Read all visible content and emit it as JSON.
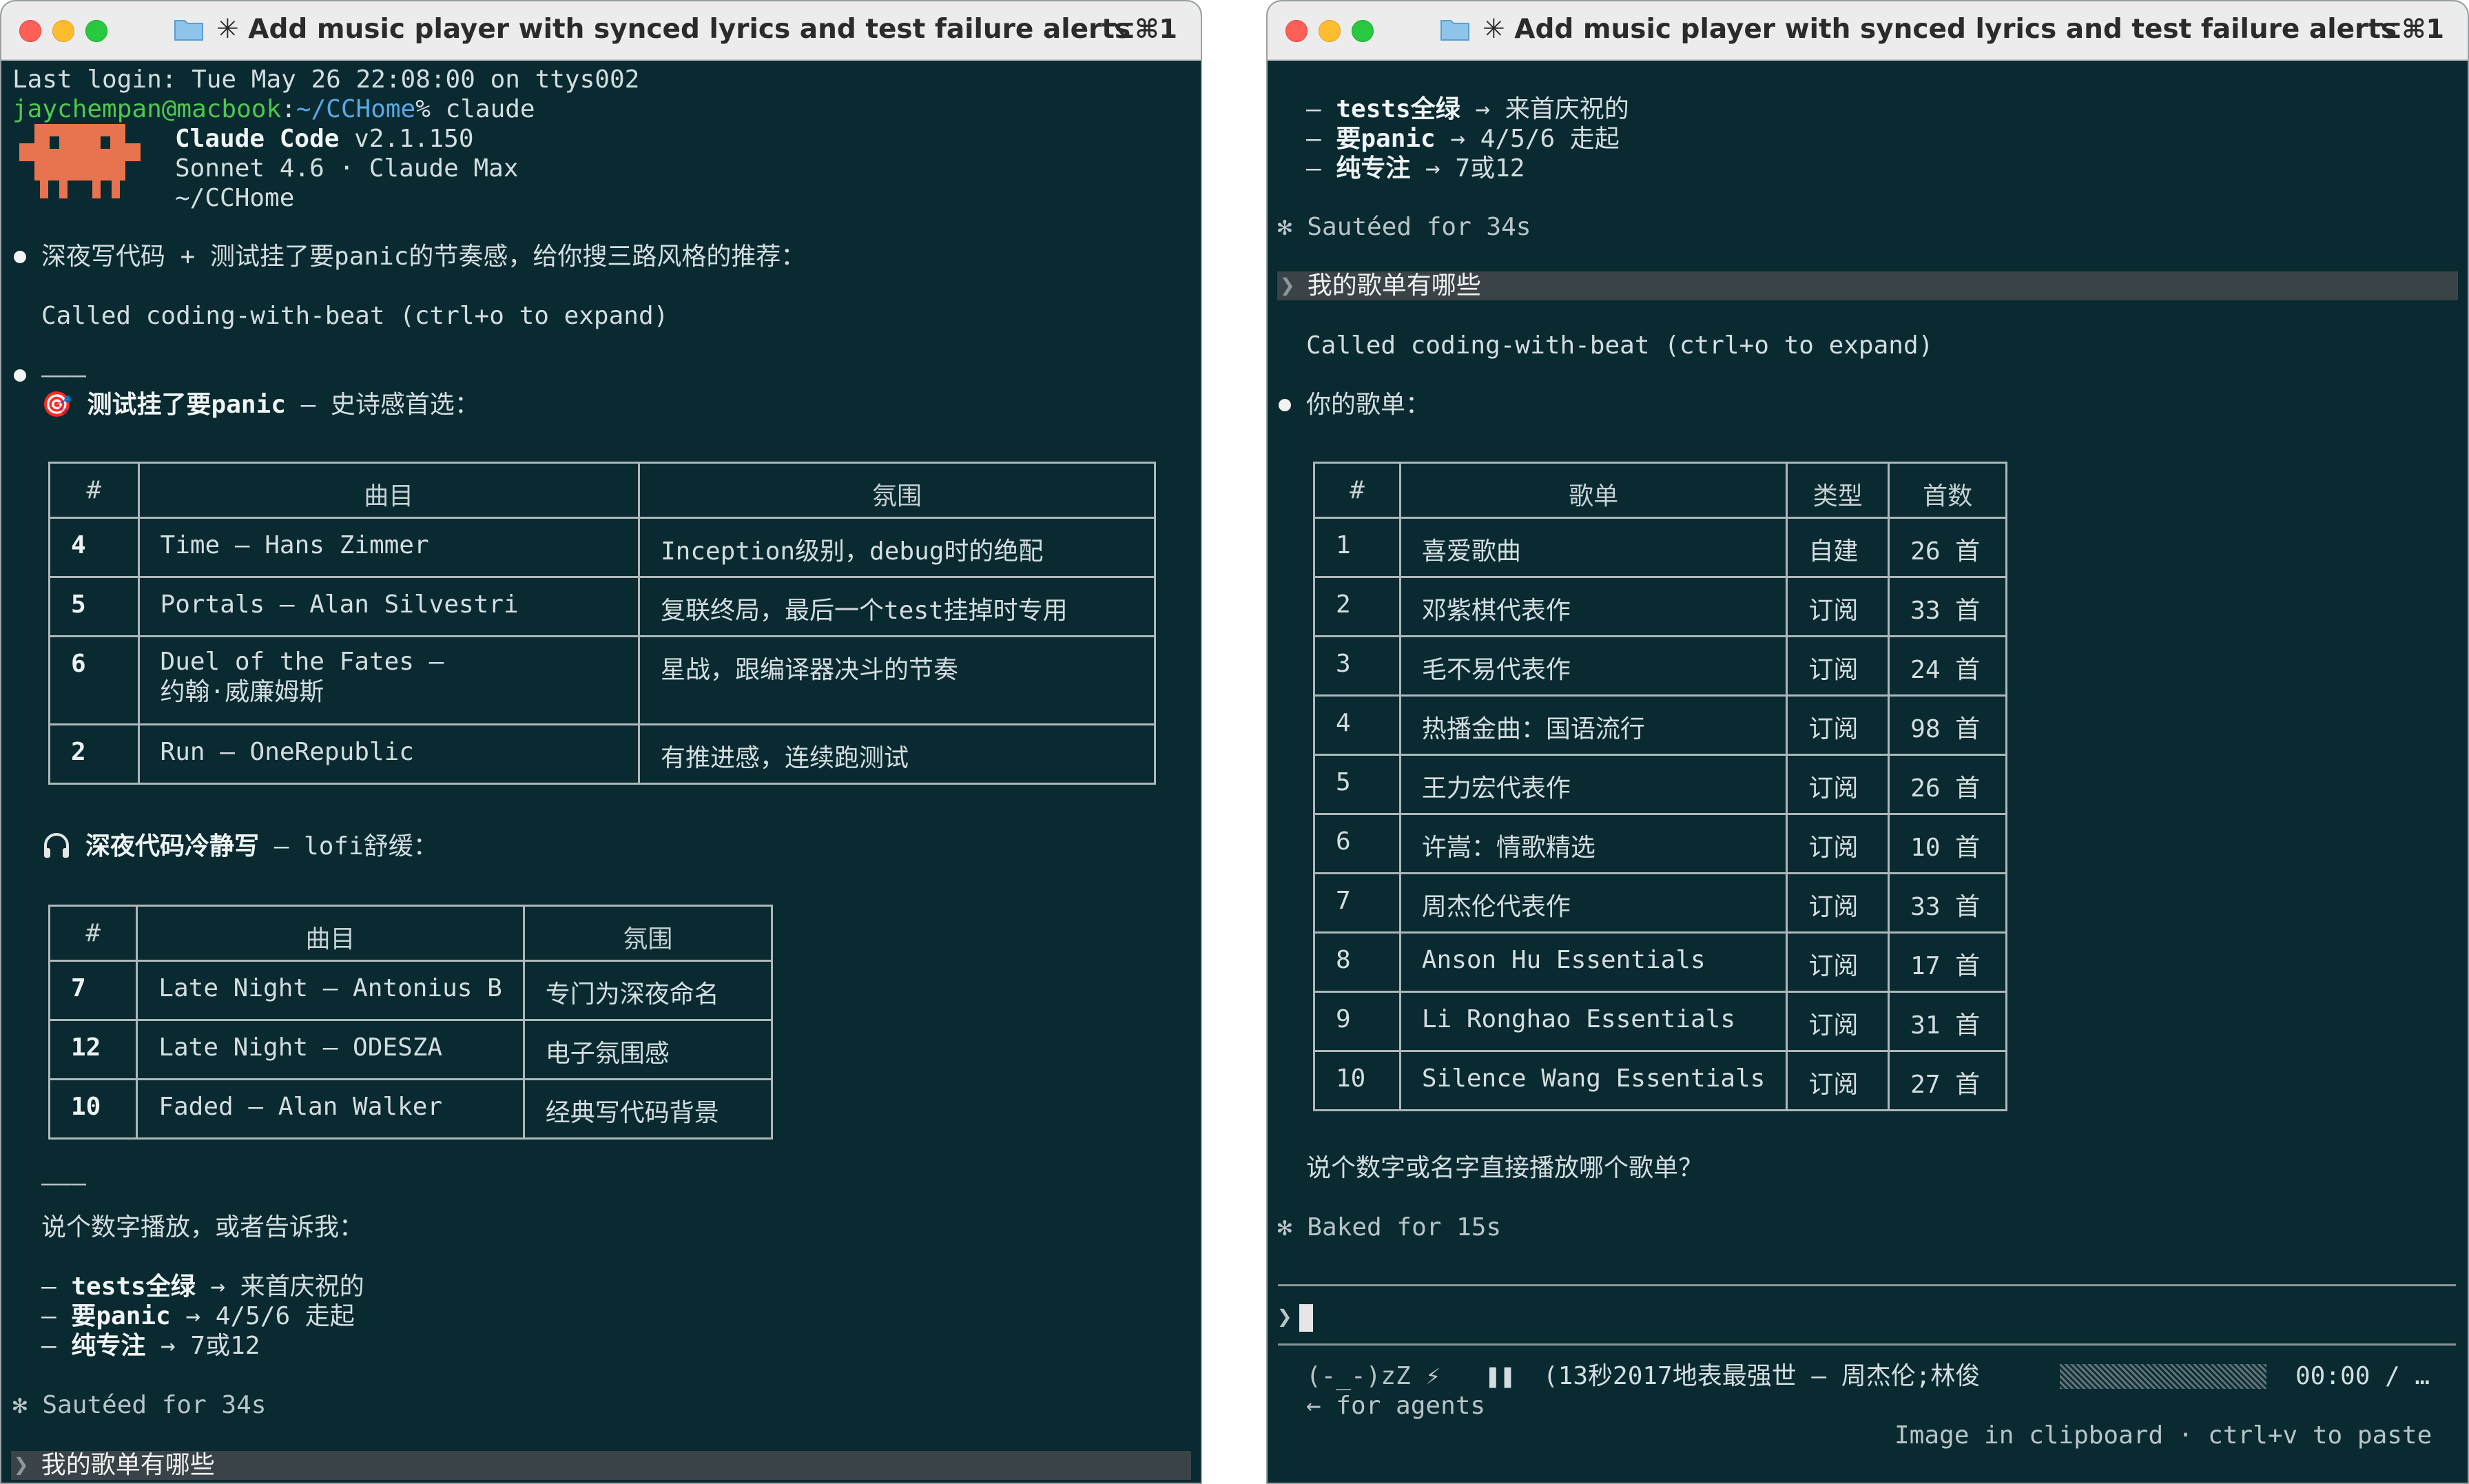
{
  "window": {
    "title": "✳ Add music player with synced lyrics and test failure alerts",
    "shortcut": "⌥⌘1"
  },
  "colors": {
    "terminal_bg": "#082a30",
    "user_bar_bg": "#3a4347",
    "prompt_user": "#4ec94e",
    "prompt_path": "#5aa9e6",
    "logo": "#e8734f"
  },
  "left": {
    "last_login": "Last login: Tue May 26 22:08:00 on ttys002",
    "prompt_user": "jaychempan@macbook",
    "prompt_sep": ":",
    "prompt_path": "~/CCHome",
    "prompt_cmd": "% claude",
    "app_name": "Claude Code",
    "app_version": " v2.1.150",
    "model": "Sonnet 4.6 · Claude Max",
    "cwd": "~/CCHome",
    "msg1": "深夜写代码 + 测试挂了要panic的节奏感，给你搜三路风格的推荐：",
    "called": "Called coding-with-beat (ctrl+o to expand)",
    "divider": "———",
    "section1_icon": "🎯",
    "section1_bold": "测试挂了要panic",
    "section1_rest": " — 史诗感首选：",
    "table1": {
      "headers": [
        "#",
        "曲目",
        "氛围"
      ],
      "rows": [
        [
          "4",
          "Time — Hans Zimmer",
          "Inception级别，debug时的绝配"
        ],
        [
          "5",
          "Portals — Alan Silvestri",
          "复联终局，最后一个test挂掉时专用"
        ],
        [
          "6",
          "Duel of the Fates —\n约翰·威廉姆斯",
          "星战，跟编译器决斗的节奏"
        ],
        [
          "2",
          "Run — OneRepublic",
          "有推进感，连续跑测试"
        ]
      ]
    },
    "section2_bold": "深夜代码冷静写",
    "section2_rest": " — lofi舒缓：",
    "table2": {
      "headers": [
        "#",
        "曲目",
        "氛围"
      ],
      "rows": [
        [
          "7",
          "Late Night — Antonius B",
          "专门为深夜命名"
        ],
        [
          "12",
          "Late Night — ODESZA",
          "电子氛围感"
        ],
        [
          "10",
          "Faded — Alan Walker",
          "经典写代码背景"
        ]
      ]
    },
    "divider2": "———",
    "prompt_play": "说个数字播放，或者告诉我：",
    "opt1_bold": "tests全绿",
    "opt1_rest": " → 来首庆祝的",
    "opt2_bold": "要panic",
    "opt2_rest": " → 4/5/6 走起",
    "opt3_bold": "纯专注",
    "opt3_rest": " → 7或12",
    "sauteed": "✻ Sautéed for 34s",
    "user_msg": "我的歌单有哪些"
  },
  "right": {
    "opt1_bold": "tests全绿",
    "opt1_rest": " → 来首庆祝的",
    "opt2_bold": "要panic",
    "opt2_rest": " → 4/5/6 走起",
    "opt3_bold": "纯专注",
    "opt3_rest": " → 7或12",
    "sauteed": "✻ Sautéed for 34s",
    "user_msg": "我的歌单有哪些",
    "called": "Called coding-with-beat (ctrl+o to expand)",
    "your_playlists": "你的歌单：",
    "playlists": {
      "headers": [
        "#",
        "歌单",
        "类型",
        "首数"
      ],
      "rows": [
        [
          "1",
          "喜爱歌曲",
          "自建",
          "26 首"
        ],
        [
          "2",
          "邓紫棋代表作",
          "订阅",
          "33 首"
        ],
        [
          "3",
          "毛不易代表作",
          "订阅",
          "24 首"
        ],
        [
          "4",
          "热播金曲：国语流行",
          "订阅",
          "98 首"
        ],
        [
          "5",
          "王力宏代表作",
          "订阅",
          "26 首"
        ],
        [
          "6",
          "许嵩：情歌精选",
          "订阅",
          "10 首"
        ],
        [
          "7",
          "周杰伦代表作",
          "订阅",
          "33 首"
        ],
        [
          "8",
          "Anson Hu Essentials",
          "订阅",
          "17 首"
        ],
        [
          "9",
          "Li Ronghao Essentials",
          "订阅",
          "31 首"
        ],
        [
          "10",
          "Silence Wang Essentials",
          "订阅",
          "27 首"
        ]
      ]
    },
    "ask": "说个数字或名字直接播放哪个歌单？",
    "baked": "✻ Baked for 15s",
    "input_prompt": "❯",
    "status_face": "(-_-)zZ ⚡",
    "pause_glyph": "❚❚",
    "now_playing": "(13秒2017地表最强世 — 周杰伦;林俊",
    "time": "00:00 / …",
    "for_agents": "← for agents",
    "clipboard": "Image in clipboard · ctrl+v to paste"
  }
}
